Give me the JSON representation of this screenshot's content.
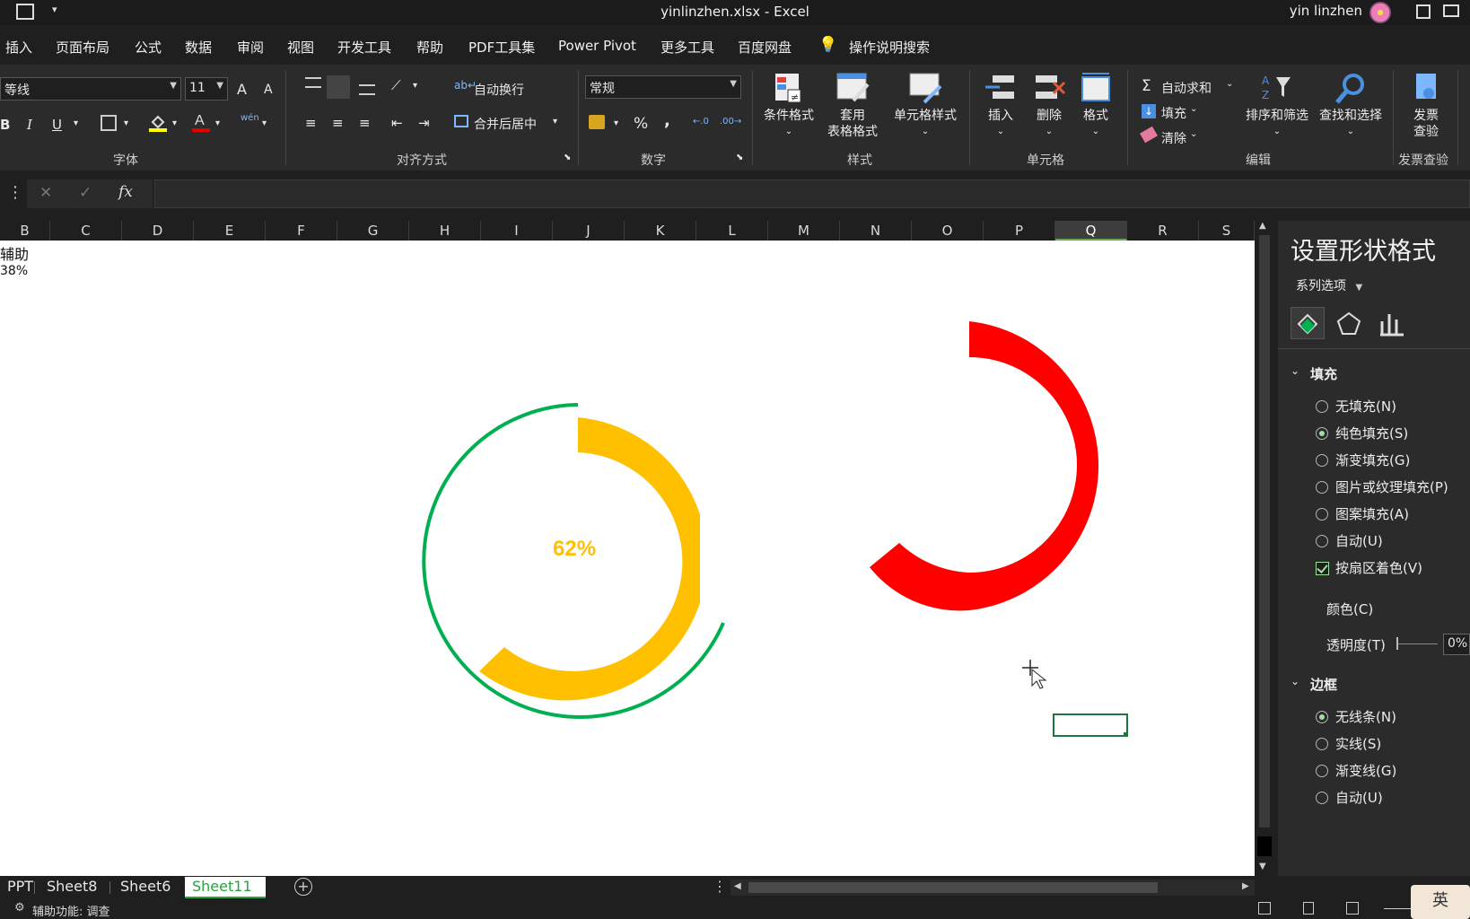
{
  "window": {
    "title": "yinlinzhen.xlsx  -  Excel",
    "user": "yin linzhen"
  },
  "menu": [
    "插入",
    "页面布局",
    "公式",
    "数据",
    "审阅",
    "视图",
    "开发工具",
    "帮助",
    "PDF工具集",
    "Power Pivot",
    "更多工具",
    "百度网盘",
    "操作说明搜索"
  ],
  "ribbon": {
    "font_name": "等线",
    "font_size": "11",
    "grow_font": "A",
    "shrink_font": "A",
    "bold": "B",
    "italic": "I",
    "underline": "U",
    "phonetic": "wén",
    "wrap_text": "自动换行",
    "merge_center": "合并后居中",
    "number_format": "常规",
    "percent": "%",
    "comma": ",",
    "conditional_format": "条件格式",
    "table_format_1": "套用",
    "table_format_2": "表格格式",
    "cell_styles": "单元格样式",
    "insert": "插入",
    "delete": "删除",
    "format": "格式",
    "autosum": "自动求和",
    "fill": "填充",
    "clear": "清除",
    "sort_filter": "排序和筛选",
    "find_select": "查找和选择",
    "invoice_1": "发票",
    "invoice_2": "查验",
    "groups": {
      "font": "字体",
      "alignment": "对齐方式",
      "number": "数字",
      "styles": "样式",
      "cells": "单元格",
      "editing": "编辑",
      "invoice": "发票查验"
    }
  },
  "formula_bar": {
    "cancel": "✕",
    "enter": "✓",
    "fx": "fx"
  },
  "columns": [
    "B",
    "C",
    "D",
    "E",
    "F",
    "G",
    "H",
    "I",
    "J",
    "K",
    "L",
    "M",
    "N",
    "O",
    "P",
    "Q",
    "R",
    "S"
  ],
  "selected_column": "Q",
  "cells": {
    "b_header": "辅助",
    "b_value": "38%"
  },
  "charts": {
    "donut_label": "62%",
    "donut_percent": 0.62,
    "colors": {
      "yellow": "#FFC000",
      "green": "#00B050",
      "red": "#FF0000"
    }
  },
  "sheet_tabs": [
    "PPT",
    "Sheet8",
    "Sheet6",
    "Sheet11"
  ],
  "active_tab": "Sheet11",
  "status": {
    "accessibility": "辅助功能: 调查",
    "ime": "英"
  },
  "panel": {
    "title": "设置形状格式",
    "series_options": "系列选项",
    "fill_section": "填充",
    "fill_options": [
      {
        "label": "无填充(N)",
        "selected": false
      },
      {
        "label": "纯色填充(S)",
        "selected": true
      },
      {
        "label": "渐变填充(G)",
        "selected": false
      },
      {
        "label": "图片或纹理填充(P)",
        "selected": false
      },
      {
        "label": "图案填充(A)",
        "selected": false
      },
      {
        "label": "自动(U)",
        "selected": false
      }
    ],
    "vary_colors": "按扇区着色(V)",
    "color": "颜色(C)",
    "transparency": "透明度(T)",
    "transparency_value": "0%",
    "border_section": "边框",
    "border_options": [
      {
        "label": "无线条(N)",
        "selected": true
      },
      {
        "label": "实线(S)",
        "selected": false
      },
      {
        "label": "渐变线(G)",
        "selected": false
      },
      {
        "label": "自动(U)",
        "selected": false
      }
    ]
  }
}
